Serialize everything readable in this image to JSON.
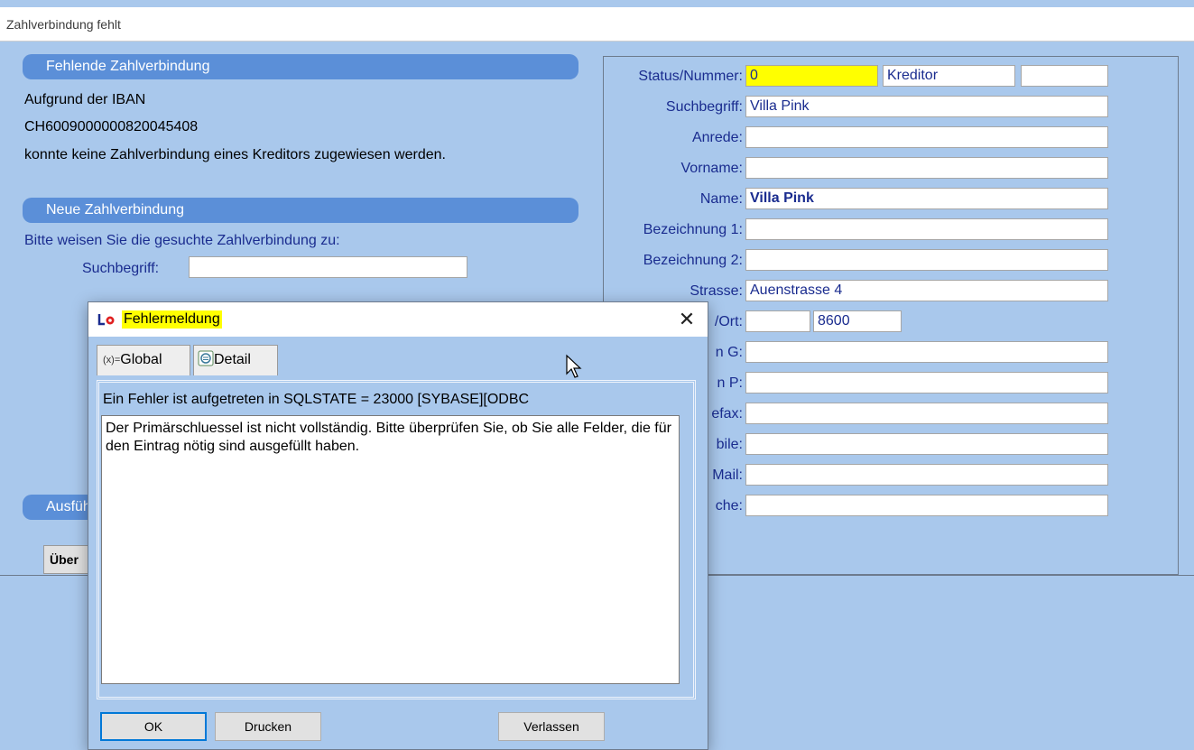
{
  "main_window": {
    "title": "Zahlverbindung fehlt"
  },
  "left": {
    "missing_header": "Fehlende Zahlverbindung",
    "line1": "Aufgrund der IBAN",
    "iban": "CH6009000000820045408",
    "line3": "konnte keine Zahlverbindung eines Kreditors zugewiesen werden.",
    "new_header": "Neue Zahlverbindung",
    "instruction": "Bitte weisen Sie die gesuchte Zahlverbindung zu:",
    "search_label": "Suchbegriff:",
    "search_value": "",
    "execute_header": "Ausfüh",
    "partial_button": "Über"
  },
  "form": {
    "status_label": "Status/Nummer:",
    "status_value": "0",
    "status_type": "Kreditor",
    "status_extra": "",
    "search_label": "Suchbegriff:",
    "search_value": "Villa Pink",
    "salutation_label": "Anrede:",
    "salutation_value": "",
    "firstname_label": "Vorname:",
    "firstname_value": "",
    "name_label": "Name:",
    "name_value": "Villa Pink",
    "desc1_label": "Bezeichnung 1:",
    "desc1_value": "",
    "desc2_label": "Bezeichnung 2:",
    "desc2_value": "",
    "street_label": "Strasse:",
    "street_value": "Auenstrasse 4",
    "city_label": "/Ort:",
    "zip_value": "",
    "city_value": "8600",
    "phone_g_label": "n G:",
    "phone_g_value": "",
    "phone_p_label": "n P:",
    "phone_p_value": "",
    "fax_label": "efax:",
    "fax_value": "",
    "mobile_label": "bile:",
    "mobile_value": "",
    "email_label": "Mail:",
    "email_value": "",
    "language_label": "che:",
    "language_value": ""
  },
  "dialog": {
    "title": "Fehlermeldung",
    "close_glyph": "✕",
    "tabs": [
      {
        "label": "Global",
        "icon_text": "(x)="
      },
      {
        "label": "Detail"
      }
    ],
    "error_heading": "Ein Fehler ist aufgetreten in    SQLSTATE = 23000 [SYBASE][ODBC",
    "error_message": "Der Primärschluessel ist nicht vollständig. Bitte überprüfen Sie, ob Sie alle Felder, die für den Eintrag nötig sind ausgefüllt haben.",
    "buttons": {
      "ok": "OK",
      "print": "Drucken",
      "leave": "Verlassen"
    }
  }
}
